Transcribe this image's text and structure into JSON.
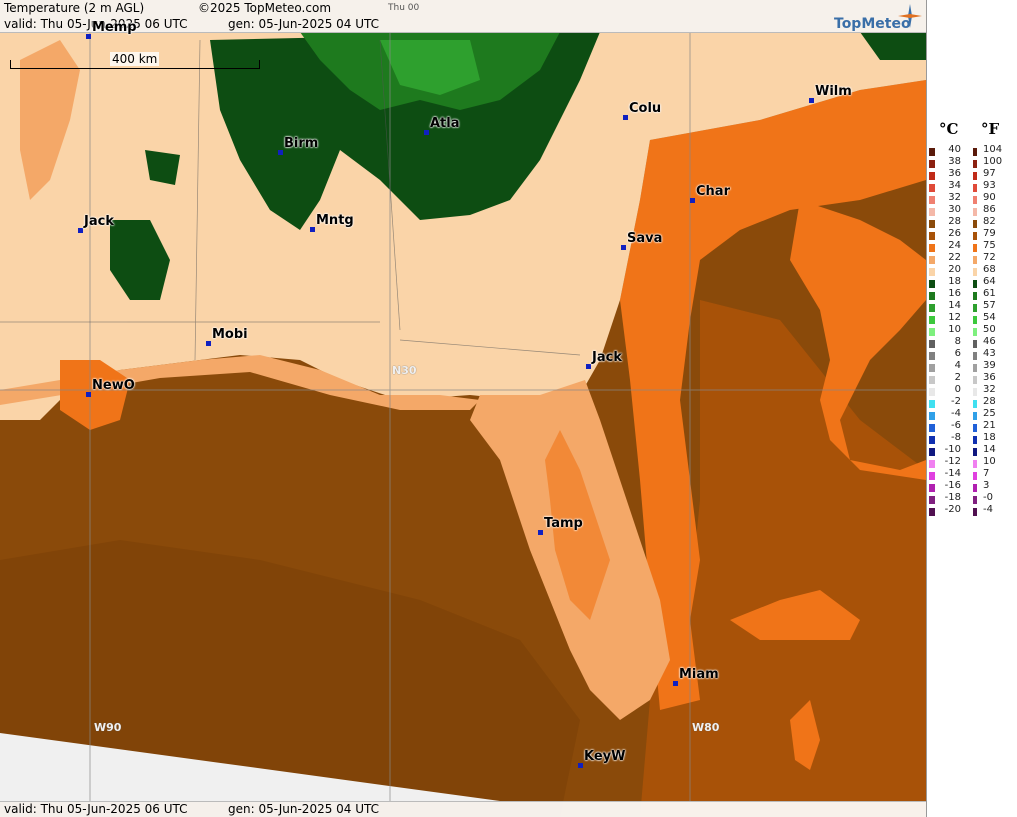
{
  "header": {
    "title": "Temperature (2 m AGL)",
    "copyright": "©2025 TopMeteo.com",
    "valid": "valid:  Thu  05-Jun-2025  06 UTC",
    "gen": "gen:  05-Jun-2025 04 UTC",
    "run": "Thu 00",
    "brand": "TopMeteo"
  },
  "footer": {
    "valid": "valid:  Thu  05-Jun-2025  06 UTC",
    "gen": "gen:  05-Jun-2025 04 UTC"
  },
  "scale": {
    "label": "400 km"
  },
  "cities": [
    {
      "name": "Birm"
    },
    {
      "name": "Atla"
    },
    {
      "name": "Colu"
    },
    {
      "name": "Wilm"
    },
    {
      "name": "Char"
    },
    {
      "name": "Sava"
    },
    {
      "name": "Jack"
    },
    {
      "name": "Mntg"
    },
    {
      "name": "Jack"
    },
    {
      "name": "Mobi"
    },
    {
      "name": "NewO"
    },
    {
      "name": "Tamp"
    },
    {
      "name": "Miam"
    },
    {
      "name": "KeyW"
    },
    {
      "name": "Memp"
    }
  ],
  "grid_labels": {
    "n30": "N30",
    "w90": "W90",
    "w80": "W80"
  },
  "legend": {
    "unit_c": "°C",
    "unit_f": "°F",
    "rows": [
      {
        "c": "40",
        "f": "104",
        "color": "#5a1a0a"
      },
      {
        "c": "38",
        "f": "100",
        "color": "#8b2010"
      },
      {
        "c": "36",
        "f": "97",
        "color": "#c02a18"
      },
      {
        "c": "34",
        "f": "93",
        "color": "#e04a38"
      },
      {
        "c": "32",
        "f": "90",
        "color": "#f08070"
      },
      {
        "c": "30",
        "f": "86",
        "color": "#f4b8a8"
      },
      {
        "c": "28",
        "f": "82",
        "color": "#8a4a0a"
      },
      {
        "c": "26",
        "f": "79",
        "color": "#a85208"
      },
      {
        "c": "24",
        "f": "75",
        "color": "#f07418"
      },
      {
        "c": "22",
        "f": "72",
        "color": "#f4a868"
      },
      {
        "c": "20",
        "f": "68",
        "color": "#fad4a8"
      },
      {
        "c": "18",
        "f": "64",
        "color": "#0d4d12"
      },
      {
        "c": "16",
        "f": "61",
        "color": "#1e7a1e"
      },
      {
        "c": "14",
        "f": "57",
        "color": "#2ea02e"
      },
      {
        "c": "12",
        "f": "54",
        "color": "#3cc83c"
      },
      {
        "c": "10",
        "f": "50",
        "color": "#7ef07e"
      },
      {
        "c": "8",
        "f": "46",
        "color": "#606060"
      },
      {
        "c": "6",
        "f": "43",
        "color": "#808080"
      },
      {
        "c": "4",
        "f": "39",
        "color": "#a0a0a0"
      },
      {
        "c": "2",
        "f": "36",
        "color": "#c8c8c8"
      },
      {
        "c": "0",
        "f": "32",
        "color": "#e8e8e8"
      },
      {
        "c": "-2",
        "f": "28",
        "color": "#40e0f0"
      },
      {
        "c": "-4",
        "f": "25",
        "color": "#30a0e8"
      },
      {
        "c": "-6",
        "f": "21",
        "color": "#2060d8"
      },
      {
        "c": "-8",
        "f": "18",
        "color": "#1030b0"
      },
      {
        "c": "-10",
        "f": "14",
        "color": "#101880"
      },
      {
        "c": "-12",
        "f": "10",
        "color": "#f080f0"
      },
      {
        "c": "-14",
        "f": "7",
        "color": "#e040e0"
      },
      {
        "c": "-16",
        "f": "3",
        "color": "#b020b0"
      },
      {
        "c": "-18",
        "f": "-0",
        "color": "#802080"
      },
      {
        "c": "-20",
        "f": "-4",
        "color": "#501050"
      }
    ]
  }
}
